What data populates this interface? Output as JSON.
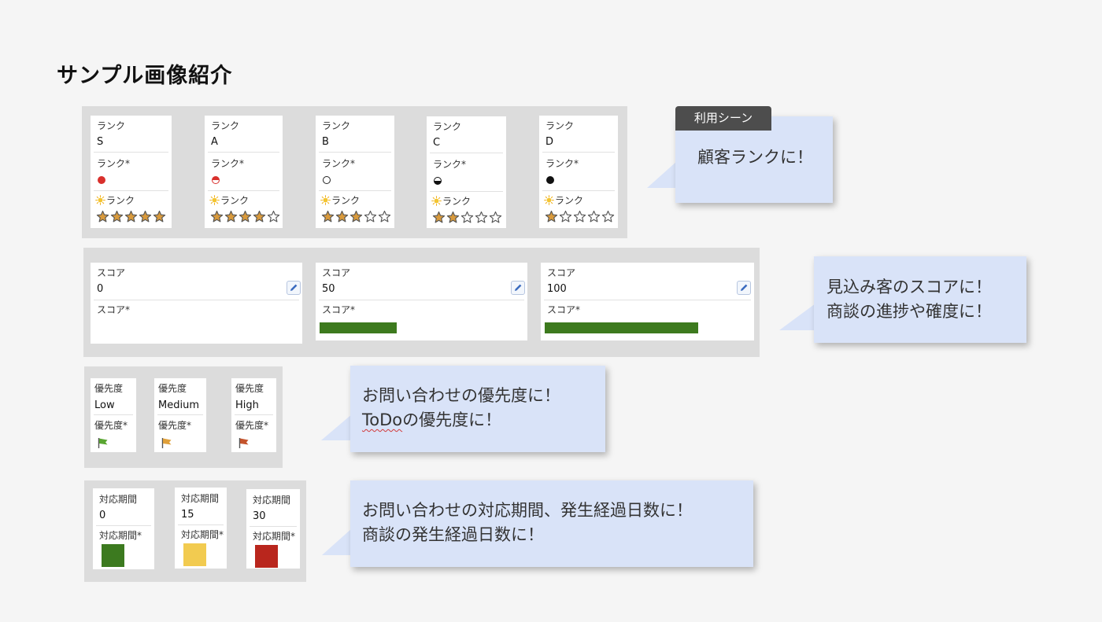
{
  "title": "サンプル画像紹介",
  "rank_section": {
    "field_label": "ランク",
    "field_label_dot": "ランク*",
    "field_label_star": "ランク",
    "sun_icon": "sun-icon",
    "cards": [
      {
        "value": "S",
        "dot": "full",
        "stars": 5
      },
      {
        "value": "A",
        "dot": "half-red",
        "stars": 4
      },
      {
        "value": "B",
        "dot": "empty",
        "stars": 3
      },
      {
        "value": "C",
        "dot": "half-black",
        "stars": 2
      },
      {
        "value": "D",
        "dot": "full-black",
        "stars": 1
      }
    ],
    "star_max": 5,
    "colors": {
      "red_dot": "#d9302c",
      "star_fill": "#d99a3c",
      "star_outline": "#555555"
    }
  },
  "score_section": {
    "field_label": "スコア",
    "field_label_bar": "スコア*",
    "cards": [
      {
        "value": "0",
        "percent": 0
      },
      {
        "value": "50",
        "percent": 50
      },
      {
        "value": "100",
        "percent": 100
      }
    ],
    "colors": {
      "bar": "#3d7a1e",
      "edit_icon": "#3b6bbf"
    }
  },
  "priority_section": {
    "field_label": "優先度",
    "field_label_flag": "優先度*",
    "cards": [
      {
        "value": "Low",
        "flag_color": "#5aa632"
      },
      {
        "value": "Medium",
        "flag_color": "#e0a03a"
      },
      {
        "value": "High",
        "flag_color": "#c4542d"
      }
    ]
  },
  "period_section": {
    "field_label": "対応期間",
    "field_label_color": "対応期間*",
    "cards": [
      {
        "value": "0",
        "color": "#3c7a1f"
      },
      {
        "value": "15",
        "color": "#f2cb50"
      },
      {
        "value": "30",
        "color": "#b9261d"
      }
    ]
  },
  "callouts": {
    "tag": "利用シーン",
    "rank": [
      "顧客ランクに！"
    ],
    "score": [
      "見込み客のスコアに！",
      "商談の進捗や確度に！"
    ],
    "priority_line1": "お問い合わせの優先度に！",
    "priority_line2_underlined": "ToDo",
    "priority_line2_rest": "の優先度に！",
    "period": [
      "お問い合わせの対応期間、発生経過日数に！",
      "商談の発生経過日数に！"
    ],
    "color": "#d9e3f8"
  }
}
